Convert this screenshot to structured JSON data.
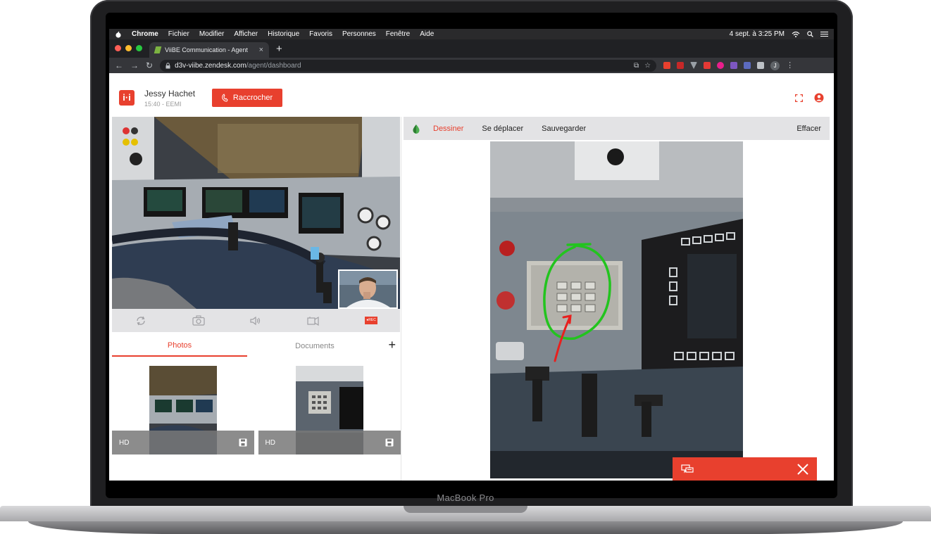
{
  "device": {
    "brand": "MacBook Pro"
  },
  "menubar": {
    "app": "Chrome",
    "items": [
      "Fichier",
      "Modifier",
      "Afficher",
      "Historique",
      "Favoris",
      "Personnes",
      "Fenêtre",
      "Aide"
    ],
    "clock": "4 sept. à  3:25 PM"
  },
  "browser": {
    "tab_title": "ViiBE Communication - Agent",
    "url_host": "d3v-viibe.zendesk.com",
    "url_path": "/agent/dashboard",
    "profile_initial": "J"
  },
  "header": {
    "logo": "i·i",
    "caller_name": "Jessy Hachet",
    "caller_meta": "15:40 - EEMI",
    "hangup_label": "Raccrocher"
  },
  "video_controls": {
    "rec_label": "●REC"
  },
  "media_tabs": {
    "photos": "Photos",
    "documents": "Documents",
    "add": "+"
  },
  "thumbnails": [
    {
      "badge": "HD"
    },
    {
      "badge": "HD"
    }
  ],
  "drawing_toolbar": {
    "draw": "Dessiner",
    "move": "Se déplacer",
    "save": "Sauvegarder",
    "clear": "Effacer"
  },
  "colors": {
    "accent": "#e8402e",
    "pen_green": "#22c41e",
    "pen_red": "#e8201e"
  }
}
